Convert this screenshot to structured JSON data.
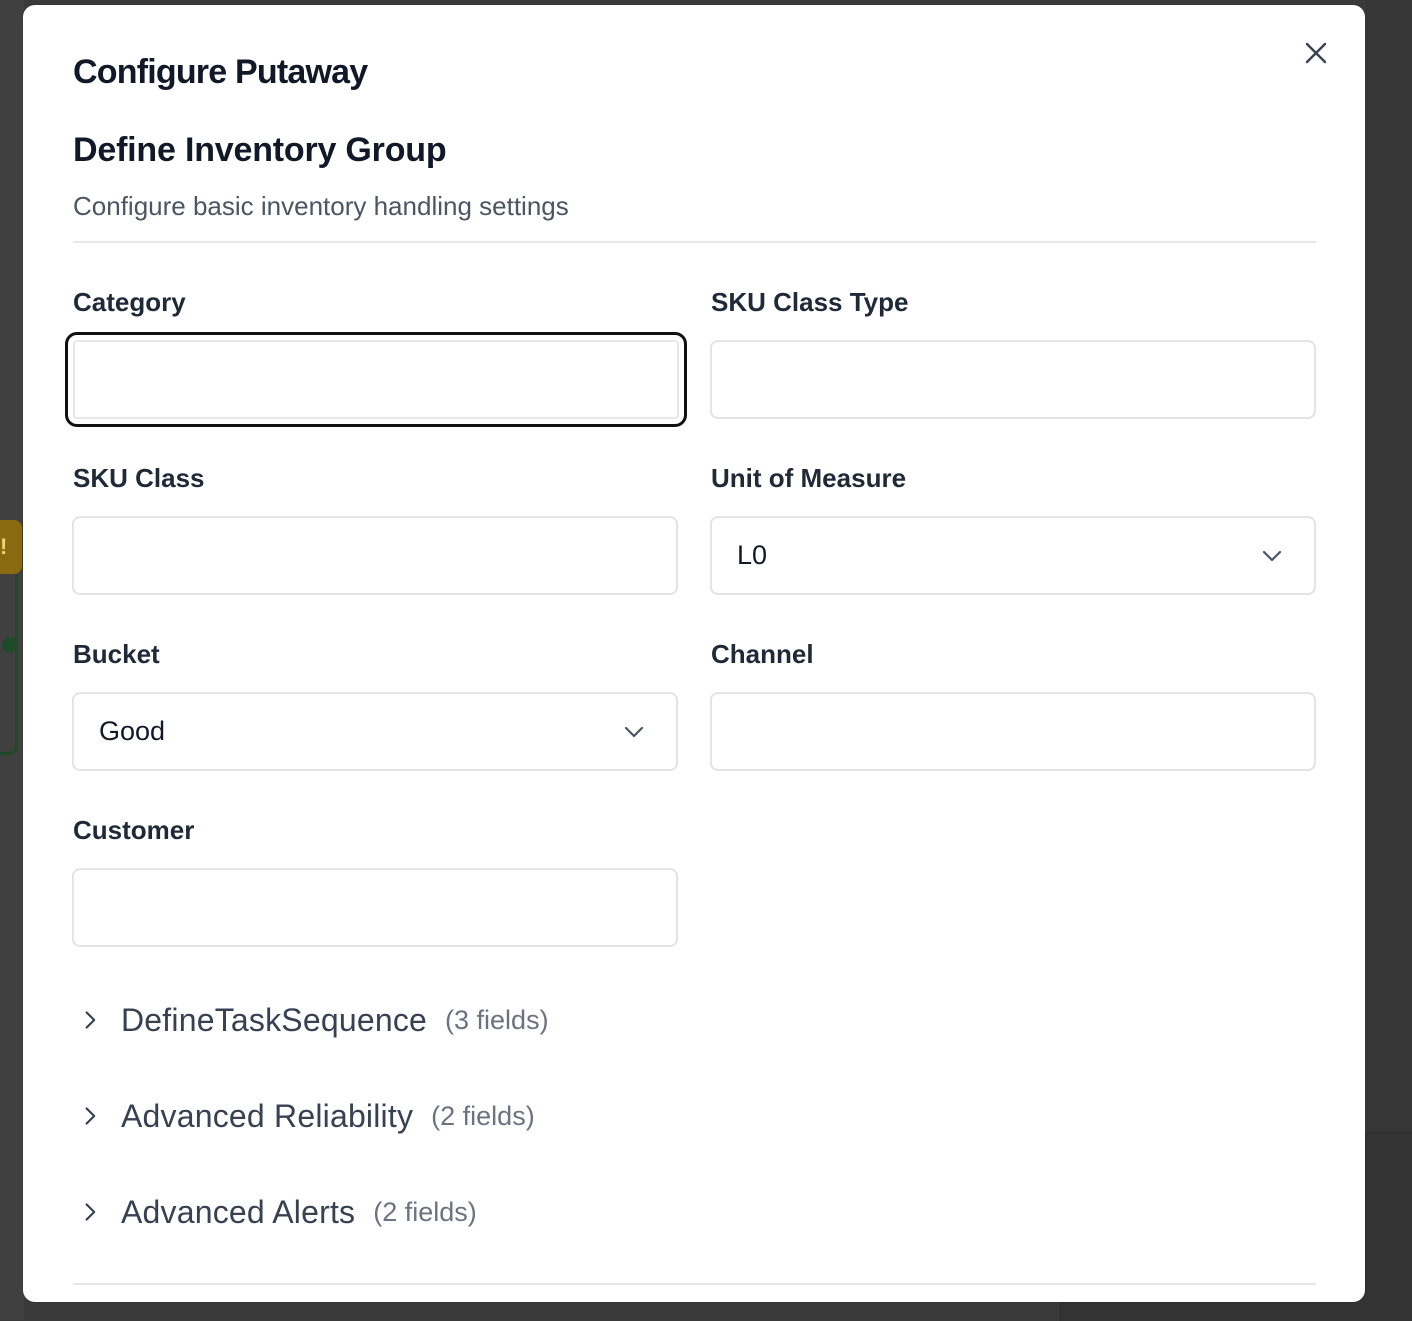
{
  "modal": {
    "title": "Configure Putaway",
    "close_icon": "close-icon"
  },
  "section": {
    "title": "Define Inventory Group",
    "subtitle": "Configure basic inventory handling settings"
  },
  "fields": {
    "category": {
      "label": "Category",
      "value": ""
    },
    "sku_class_type": {
      "label": "SKU Class Type",
      "value": ""
    },
    "sku_class": {
      "label": "SKU Class",
      "value": ""
    },
    "unit_of_measure": {
      "label": "Unit of Measure",
      "value": "L0"
    },
    "bucket": {
      "label": "Bucket",
      "value": "Good"
    },
    "channel": {
      "label": "Channel",
      "value": ""
    },
    "customer": {
      "label": "Customer",
      "value": ""
    }
  },
  "accordions": [
    {
      "title": "DefineTaskSequence",
      "count": "(3 fields)"
    },
    {
      "title": "Advanced Reliability",
      "count": "(2 fields)"
    },
    {
      "title": "Advanced Alerts",
      "count": "(2 fields)"
    }
  ],
  "background": {
    "badge_text": "!"
  },
  "colors": {
    "text_primary": "#111827",
    "text_secondary": "#4b5563",
    "border": "#e2e4e8",
    "focus_ring": "#111111"
  }
}
